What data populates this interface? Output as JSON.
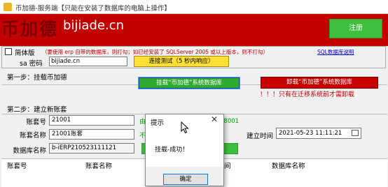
{
  "window": {
    "title": "币加德-服务端【只能在安装了数据库的电脑上操作】"
  },
  "banner": {
    "logo_cn": "币加德",
    "logo_url": "bijiade.cn",
    "register_label": "注册",
    "background_color": "#c30000"
  },
  "settings": {
    "simplified_label": "简体版",
    "simplified_checked": false,
    "db_hint": "（要使用 erp 自带的数据库，则打勾；如已经安装了 SQLServer 2005 或以上版本，则不打勾）",
    "db_help_link": "SQL数据库说明",
    "sa_label": "sa 密码",
    "sa_password_value": "bijiade.cn",
    "test_connection_label": "连接测试（5 秒内响应）"
  },
  "step1": {
    "label": "第一步：挂载币加德",
    "mount_button_label": "挂载“币加德”系统数据库",
    "unmount_button_label": "卸载“币加德”系统数据库",
    "unmount_warning": "！！！只有在迁移系统前才需卸载"
  },
  "step2": {
    "label": "第二步：建立新账套",
    "account_no_label": "账套号",
    "account_no_value": "21001",
    "account_no_hint_left": "由“",
    "account_no_hint_right": "例：18001",
    "account_name_label": "账套名称",
    "account_name_value": "21001账套",
    "account_name_hint_left": "不能",
    "db_name_label": "数据库名称",
    "db_name_value": "b-iERP210523111121",
    "create_time_label": "建立时间",
    "create_time_value": "2021-05-23 11:11:21"
  },
  "table": {
    "columns": [
      "账套号",
      "账套名称",
      "间",
      "数据库名称"
    ],
    "rows": []
  },
  "dialog": {
    "title": "提示",
    "close_glyph": "✕",
    "message": "挂载-成功！",
    "ok_label": "确定"
  }
}
